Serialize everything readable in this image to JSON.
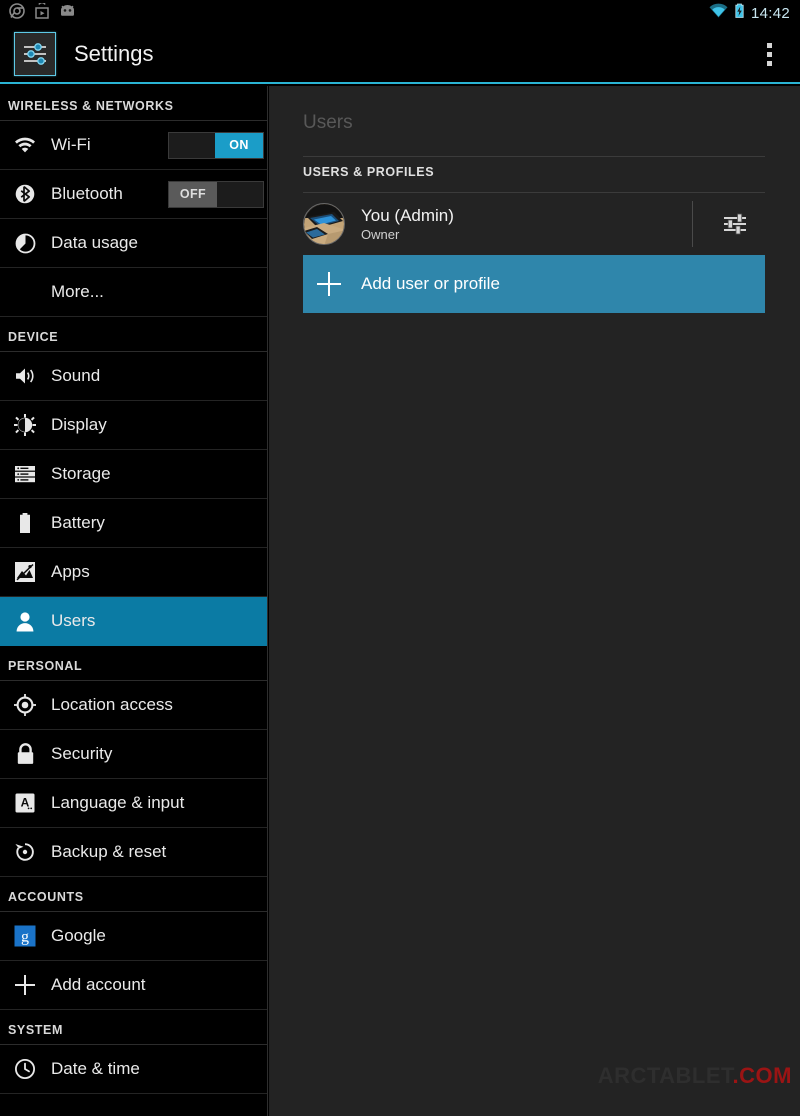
{
  "statusbar": {
    "notification_icons": [
      "chrome-icon",
      "play-store-icon",
      "android-app-icon"
    ],
    "wifi_icon": "wifi-icon",
    "battery_icon": "battery-charging-icon",
    "clock": "14:42",
    "accent_color": "#2ab4d4"
  },
  "actionbar": {
    "app_icon": "settings-sliders-icon",
    "title": "Settings",
    "overflow_icon": "overflow-menu-icon",
    "underline_color": "#2ab4d4"
  },
  "sidebar": {
    "accent_color": "#0b7ba4",
    "sections": [
      {
        "label": "WIRELESS & NETWORKS",
        "items": [
          {
            "label": "Wi-Fi",
            "icon": "wifi-icon",
            "toggle": {
              "state": "on",
              "label": "ON"
            },
            "selected": false
          },
          {
            "label": "Bluetooth",
            "icon": "bluetooth-icon",
            "toggle": {
              "state": "off",
              "label": "OFF"
            },
            "selected": false
          },
          {
            "label": "Data usage",
            "icon": "data-usage-icon",
            "selected": false
          },
          {
            "label": "More...",
            "icon": null,
            "selected": false
          }
        ]
      },
      {
        "label": "DEVICE",
        "items": [
          {
            "label": "Sound",
            "icon": "sound-icon",
            "selected": false
          },
          {
            "label": "Display",
            "icon": "display-icon",
            "selected": false
          },
          {
            "label": "Storage",
            "icon": "storage-icon",
            "selected": false
          },
          {
            "label": "Battery",
            "icon": "battery-icon",
            "selected": false
          },
          {
            "label": "Apps",
            "icon": "apps-icon",
            "selected": false
          },
          {
            "label": "Users",
            "icon": "users-icon",
            "selected": true
          }
        ]
      },
      {
        "label": "PERSONAL",
        "items": [
          {
            "label": "Location access",
            "icon": "location-icon",
            "selected": false
          },
          {
            "label": "Security",
            "icon": "lock-icon",
            "selected": false
          },
          {
            "label": "Language & input",
            "icon": "language-icon",
            "selected": false
          },
          {
            "label": "Backup & reset",
            "icon": "backup-reset-icon",
            "selected": false
          }
        ]
      },
      {
        "label": "ACCOUNTS",
        "items": [
          {
            "label": "Google",
            "icon": "google-icon",
            "selected": false
          },
          {
            "label": "Add account",
            "icon": "plus-icon",
            "selected": false
          }
        ]
      },
      {
        "label": "SYSTEM",
        "items": [
          {
            "label": "Date & time",
            "icon": "clock-icon",
            "selected": false
          }
        ]
      }
    ]
  },
  "main": {
    "title": "Users",
    "section_label": "USERS & PROFILES",
    "user": {
      "avatar": "user-photo-avatar",
      "name": "You (Admin)",
      "subtitle": "Owner",
      "settings_icon": "user-settings-sliders-icon"
    },
    "add_button": {
      "icon": "plus-icon",
      "label": "Add user or profile",
      "color": "#2f86ab"
    }
  },
  "watermark": {
    "name": "ARCTABLET",
    "tld": ".COM",
    "name_color": "#2e2e2e",
    "tld_color": "#9b1414"
  }
}
